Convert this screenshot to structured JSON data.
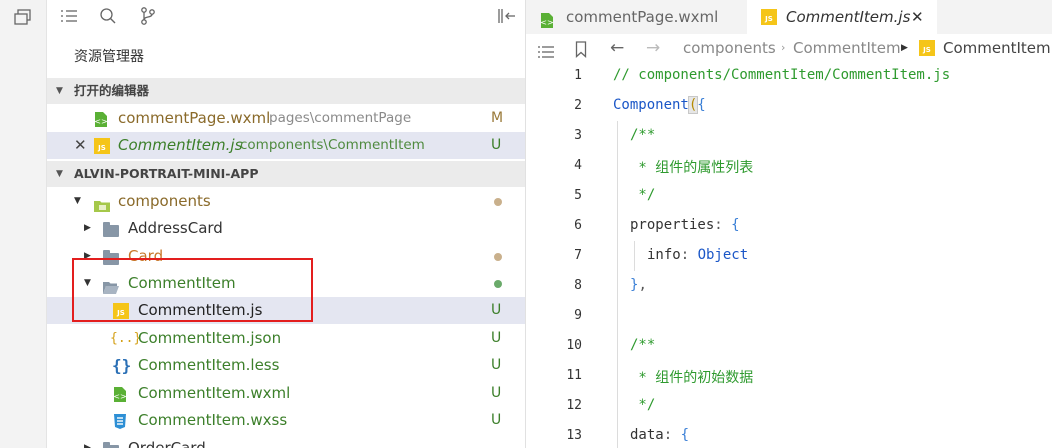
{
  "sidebar": {
    "title": "资源管理器",
    "open_editors": {
      "header": "打开的编辑器",
      "items": [
        {
          "name": "commentPage.wxml",
          "path": "pages\\commentPage",
          "badge": "M"
        },
        {
          "name": "CommentItem.js",
          "path": "components\\CommentItem",
          "badge": "U"
        }
      ]
    },
    "project": {
      "header": "ALVIN-PORTRAIT-MINI-APP",
      "tree": [
        {
          "name": "components"
        },
        {
          "name": "AddressCard"
        },
        {
          "name": "Card"
        },
        {
          "name": "CommentItem"
        },
        {
          "name": "CommentItem.js",
          "badge": "U"
        },
        {
          "name": "CommentItem.json",
          "badge": "U"
        },
        {
          "name": "CommentItem.less",
          "badge": "U"
        },
        {
          "name": "CommentItem.wxml",
          "badge": "U"
        },
        {
          "name": "CommentItem.wxss",
          "badge": "U"
        },
        {
          "name": "OrderCard"
        }
      ]
    }
  },
  "tabs": [
    {
      "label": "commentPage.wxml"
    },
    {
      "label": "CommentItem.js"
    }
  ],
  "breadcrumb": [
    "components",
    "CommentItem",
    "CommentItem.js"
  ],
  "code": {
    "line_numbers": [
      "1",
      "2",
      "3",
      "4",
      "5",
      "6",
      "7",
      "8",
      "9",
      "10",
      "11",
      "12",
      "13"
    ],
    "l1": "// components/CommentItem/CommentItem.js",
    "l2_a": "Component",
    "l2_b": "(",
    "l2_c": "{",
    "l3": "/**",
    "l4": " * 组件的属性列表",
    "l5": " */",
    "l6_a": "properties",
    "l6_b": ": ",
    "l6_c": "{",
    "l7_a": "info",
    "l7_b": ": ",
    "l7_c": "Object",
    "l8_a": "}",
    "l8_b": ",",
    "l10": "/**",
    "l11": " * 组件的初始数据",
    "l12": " */",
    "l13_a": "data",
    "l13_b": ": ",
    "l13_c": "{"
  },
  "colors": {
    "modified_dot": "#c8a87a",
    "added_dot": "#6aaa6a",
    "highlight_box": "#e31e1e",
    "js_icon": "#f5c518"
  }
}
